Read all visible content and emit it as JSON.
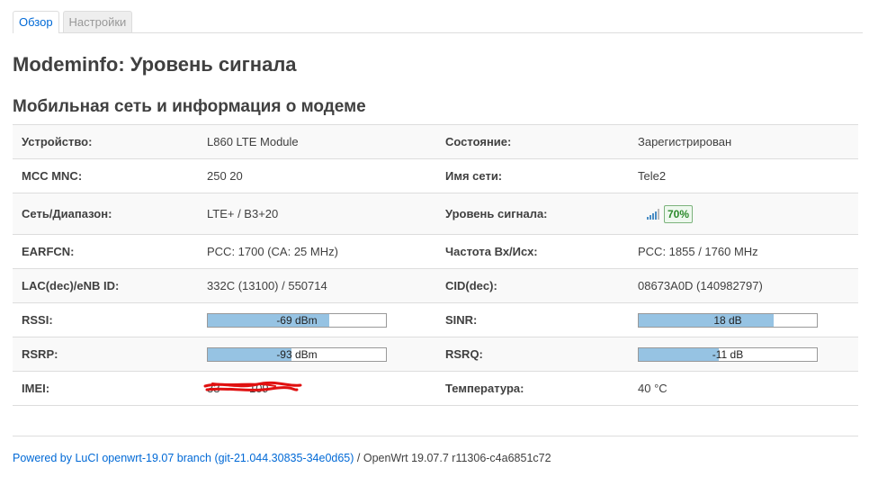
{
  "tabs": [
    {
      "label": "Обзор",
      "active": true
    },
    {
      "label": "Настройки",
      "active": false
    }
  ],
  "page_title": "Modeminfo: Уровень сигнала",
  "section_title": "Мобильная сеть и информация о модеме",
  "rows": {
    "device": {
      "label": "Устройство:",
      "value": "L860 LTE Module"
    },
    "state": {
      "label": "Состояние:",
      "value": "Зарегистрирован"
    },
    "mccmnc": {
      "label": "MCC MNC:",
      "value": "250 20"
    },
    "netname": {
      "label": "Имя сети:",
      "value": "Tele2"
    },
    "band": {
      "label": "Сеть/Диапазон:",
      "value": "LTE+ / B3+20"
    },
    "signal": {
      "label": "Уровень сигнала:",
      "value": "70%",
      "icon": "signal-bars-icon"
    },
    "earfcn": {
      "label": "EARFCN:",
      "value": "PCC: 1700 (CA: 25 MHz)"
    },
    "freq": {
      "label": "Частота Вх/Исх:",
      "value": "PCC: 1855 / 1760 MHz"
    },
    "lac": {
      "label": "LAC(dec)/eNB ID:",
      "value": "332C (13100) / 550714"
    },
    "cid": {
      "label": "CID(dec):",
      "value": "08673A0D (140982797)"
    },
    "rssi": {
      "label": "RSSI:",
      "value": "-69 dBm",
      "fill_percent": 68
    },
    "sinr": {
      "label": "SINR:",
      "value": "18 dB",
      "fill_percent": 76
    },
    "rsrp": {
      "label": "RSRP:",
      "value": "-93 dBm",
      "fill_percent": 47
    },
    "rsrq": {
      "label": "RSRQ:",
      "value": "-11 dB",
      "fill_percent": 45
    },
    "imei": {
      "label": "IMEI:",
      "value": "33         109"
    },
    "temp": {
      "label": "Температура:",
      "value": "40 °C"
    }
  },
  "footer": {
    "link": "Powered by LuCI openwrt-19.07 branch (git-21.044.30835-34e0d65)",
    "text": " / OpenWrt 19.07.7 r11306-c4a6851c72"
  },
  "colors": {
    "bar_fill": "#96c3e3",
    "link": "#0069d6",
    "badge": "#2b8a2b",
    "redaction": "#e01010"
  }
}
